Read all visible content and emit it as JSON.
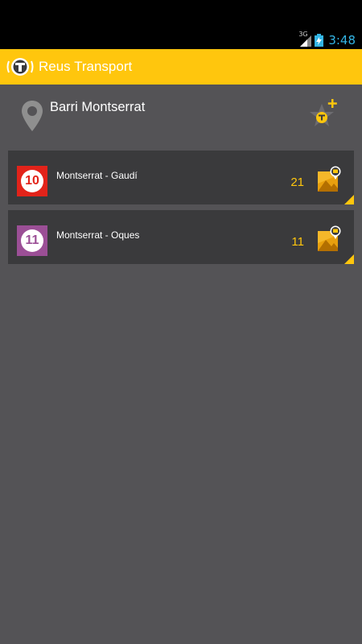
{
  "status_bar": {
    "network": "3G",
    "time": "3:48"
  },
  "action_bar": {
    "title": "Reus Transport"
  },
  "stop": {
    "name": "Barri Montserrat"
  },
  "lines": [
    {
      "number": "10",
      "name": "Montserrat - Gaudí",
      "count": "21",
      "color": "#e2231a"
    },
    {
      "number": "11",
      "name": "Montserrat - Oques",
      "count": "11",
      "color": "#9b4f96"
    }
  ],
  "colors": {
    "accent": "#ffc60d",
    "background": "#545356",
    "row": "#3a3a3c",
    "clock": "#33b5e5"
  },
  "icons": {
    "logo": "bus-stop-logo-icon",
    "pin": "map-pin-icon",
    "favorite": "add-favorite-stop-icon",
    "map": "map-bus-icon"
  }
}
